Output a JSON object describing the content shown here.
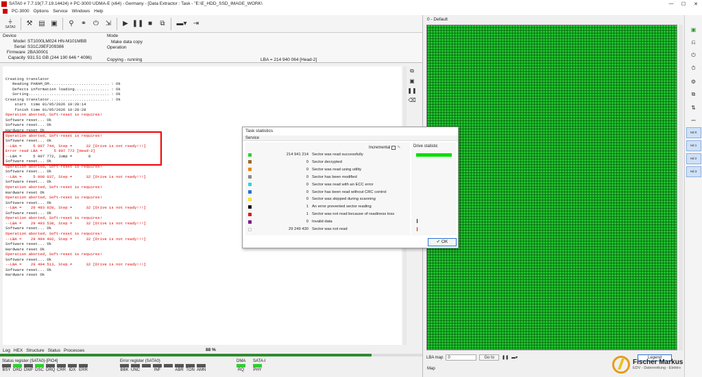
{
  "titlebar": {
    "title": "SATA0 # 7.7.19(7.7.19.14424) # PC-3000 UDMA-E (x64) - Germany - [Data Extractor : Task - \"E:\\E_HDD_SSD_IMAGE_WORK\\",
    "minimize": "—",
    "maximize": "☐",
    "close": "✕"
  },
  "menubar": {
    "items": [
      "PC-3000",
      "Options",
      "Service",
      "Windows",
      "Help"
    ]
  },
  "toolbar": {
    "sata_label": "SATA0"
  },
  "device": {
    "header": "Device",
    "rows": [
      {
        "label": "Model",
        "value": "ST1000LM024 HN-M101MBB"
      },
      {
        "label": "Serial",
        "value": "S31CJ9EF209386"
      },
      {
        "label": "Firmware",
        "value": "2BA30001"
      },
      {
        "label": "Capacity",
        "value": "931.51 GB (244 190 646 * 4096)"
      }
    ],
    "mode_header": "Mode",
    "mode_value": "Make data copy",
    "operation_header": "Operation",
    "operation_value": "Copying - running",
    "lba_text": "LBA =   214 940 064  [Head-2]"
  },
  "log": {
    "lines": [
      {
        "t": "",
        "red": false
      },
      {
        "t": "Creating translator",
        "red": false
      },
      {
        "t": "   Reading PARAM_DM.......................... : Ok",
        "red": false
      },
      {
        "t": "   Defects information loading............... : Ok",
        "red": false
      },
      {
        "t": "   Sorting................................... : Ok",
        "red": false
      },
      {
        "t": "Creating translator.......................... : Ok",
        "red": false
      },
      {
        "t": "    start  time 01/05/2026 10:28:14",
        "red": false
      },
      {
        "t": "    finish time 01/05/2026 10:28:28",
        "red": false
      },
      {
        "t": "Operation aborted, Soft-reset is requires!",
        "red": true
      },
      {
        "t": "Software reset... Ok",
        "red": false
      },
      {
        "t": "Software reset... Ok",
        "red": false
      },
      {
        "t": "Hardware reset Ok",
        "red": false
      },
      {
        "t": "Operation aborted, Soft-reset is requires!",
        "red": true
      },
      {
        "t": "Software reset... Ok",
        "red": false
      },
      {
        "t": "--LBA =     5 907 744, Step =      32 [Drive is not ready!!!]",
        "red": true
      },
      {
        "t": "Error read LBA =     5 907 772 [Head-2]",
        "red": true
      },
      {
        "t": "--LBA =     5 907 772, Jump =       8",
        "red": false
      },
      {
        "t": "Software reset... Ok",
        "red": false
      },
      {
        "t": "Operation aborted, Soft-reset is requires!",
        "red": true
      },
      {
        "t": "Software reset... Ok",
        "red": false
      },
      {
        "t": "--LBA =     5 908 037, Step =      32 [Drive is not ready!!!]",
        "red": true
      },
      {
        "t": "Software reset... Ok",
        "red": false
      },
      {
        "t": "Operation aborted, Soft-reset is requires!",
        "red": true
      },
      {
        "t": "Hardware reset Ok",
        "red": false
      },
      {
        "t": "Operation aborted, Soft-reset is requires!",
        "red": true
      },
      {
        "t": "Software reset... Ok",
        "red": false
      },
      {
        "t": "--LBA =    29 493 020, Step =      32 [Drive is not ready!!!]",
        "red": true
      },
      {
        "t": "Software reset... Ok",
        "red": false
      },
      {
        "t": "Operation aborted, Soft-reset is requires!",
        "red": true
      },
      {
        "t": "--LBA =    29 493 538, Step =      32 [Drive is not ready!!!]",
        "red": true
      },
      {
        "t": "Software reset... Ok",
        "red": false
      },
      {
        "t": "Operation aborted, Soft-reset is requires!",
        "red": true
      },
      {
        "t": "--LBA =    29 494 402, Step =      32 [Drive is not ready!!!]",
        "red": true
      },
      {
        "t": "Software reset... Ok",
        "red": false
      },
      {
        "t": "Hardware reset Ok",
        "red": false
      },
      {
        "t": "Operation aborted, Soft-reset is requires!",
        "red": true
      },
      {
        "t": "Software reset... Ok",
        "red": false
      },
      {
        "t": "--LBA =    29 494 513, Step =      32 [Drive is not ready!!!]",
        "red": true
      },
      {
        "t": "Software reset... Ok",
        "red": false
      },
      {
        "t": "Hardware reset Ok",
        "red": false
      }
    ]
  },
  "logtabs": [
    "Log",
    "HEX",
    "Structure",
    "Status",
    "Processes"
  ],
  "progress": {
    "percent_label": "88 %",
    "fraction": 0.88
  },
  "status_register": {
    "title": "Status register (SATA0)-[PIO4]",
    "bits": [
      {
        "label": "BSY",
        "on": false
      },
      {
        "label": "DRD",
        "on": true
      },
      {
        "label": "DWF",
        "on": false
      },
      {
        "label": "DSC",
        "on": true
      },
      {
        "label": "DRQ",
        "on": false
      },
      {
        "label": "CRR",
        "on": false
      },
      {
        "label": "IDX",
        "on": false
      },
      {
        "label": "ERR",
        "on": false
      }
    ]
  },
  "error_register": {
    "title": "Error register (SATA0)",
    "bits": [
      {
        "label": "BBK",
        "on": false
      },
      {
        "label": "UNC",
        "on": false
      },
      {
        "label": "",
        "on": false
      },
      {
        "label": "INF",
        "on": false
      },
      {
        "label": "",
        "on": false
      },
      {
        "label": "ABR",
        "on": false
      },
      {
        "label": "TON",
        "on": false
      },
      {
        "label": "AMN",
        "on": false
      }
    ]
  },
  "dma": {
    "title": "DMA",
    "bit": {
      "label": "RQ",
      "on": true
    }
  },
  "sata": {
    "title": "SATA-I",
    "bit": {
      "label": "PHY",
      "on": true
    }
  },
  "rightpanel": {
    "title": "0 - Default",
    "lba_map_label": "LBA map",
    "lba_input": "0",
    "goto_label": "Go to",
    "legend_label": "Legend",
    "map_tab": "Map"
  },
  "rightstrip": {
    "heads": [
      "Hd 0",
      "Hd 1",
      "Hd 2",
      "Hd 3"
    ]
  },
  "dialog": {
    "title": "Task statistics",
    "tab": "Service",
    "incremental_label": "Incremental",
    "drive_statistic_label": "Drive statistic",
    "ok_label": "OK",
    "rows": [
      {
        "count": "214 941 214",
        "label": "Sector was read successfully",
        "color": "#3cc83c"
      },
      {
        "count": "0",
        "label": "Sector decrypted",
        "color": "#9c6b2a"
      },
      {
        "count": "0",
        "label": "Sector was read using utility",
        "color": "#e08a1e"
      },
      {
        "count": "0",
        "label": "Sector has been modified",
        "color": "#8a8a8a"
      },
      {
        "count": "0",
        "label": "Sector was read with an ECC error",
        "color": "#2ed7d7"
      },
      {
        "count": "0",
        "label": "Sector has been read without CRC control",
        "color": "#2a6fd6"
      },
      {
        "count": "0",
        "label": "Sector was skipped during scanning",
        "color": "#f0e040"
      },
      {
        "count": "1",
        "label": "An error prevented sector reading",
        "color": "#111111"
      },
      {
        "count": "1",
        "label": "Sector was not read because of readiness loss",
        "color": "#d42020"
      },
      {
        "count": "0",
        "label": "Invalid data",
        "color": "#7a1e8a"
      },
      {
        "count": "29 249 430",
        "label": "Sector was not read",
        "color": "#ffffff"
      }
    ]
  },
  "watermark": {
    "name": "Fischer Markus",
    "subtitle": "EDV - Datenrettung - Elektro"
  }
}
